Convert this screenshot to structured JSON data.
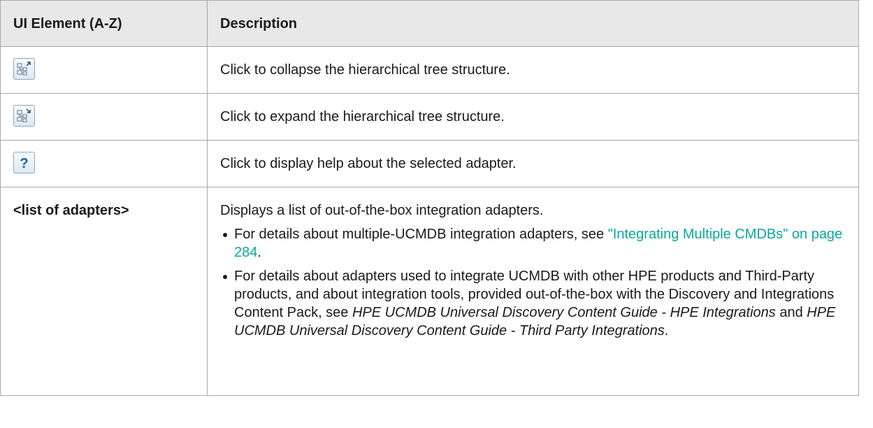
{
  "table": {
    "header": {
      "col1": "UI Element (A-Z)",
      "col2": "Description"
    },
    "rows": [
      {
        "icon": "collapse-tree-icon",
        "description": "Click to collapse the hierarchical tree structure."
      },
      {
        "icon": "expand-tree-icon",
        "description": "Click to expand the hierarchical tree structure."
      },
      {
        "icon": "help-icon",
        "description": "Click to display help about the selected adapter."
      }
    ],
    "adapters_row": {
      "element": "<list of adapters>",
      "intro": "Displays a list of out-of-the-box integration adapters.",
      "bullet1": {
        "prefix": "For details about multiple-UCMDB integration adapters, see ",
        "link": "\"Integrating Multiple CMDBs\" on page 284",
        "suffix": "."
      },
      "bullet2": {
        "prefix": "For details about adapters used to integrate UCMDB with other HPE products and Third-Party products, and about integration tools, provided out-of-the-box with the Discovery and Integrations Content Pack, see ",
        "ref1": "HPE UCMDB Universal Discovery Content Guide - HPE Integrations",
        "and": " and ",
        "ref2": "HPE UCMDB Universal Discovery Content Guide - Third Party Integrations",
        "suffix": "."
      }
    }
  },
  "colors": {
    "header_bg": "#e8e8e8",
    "border": "#a8a8a8",
    "link": "#0aa89a"
  }
}
